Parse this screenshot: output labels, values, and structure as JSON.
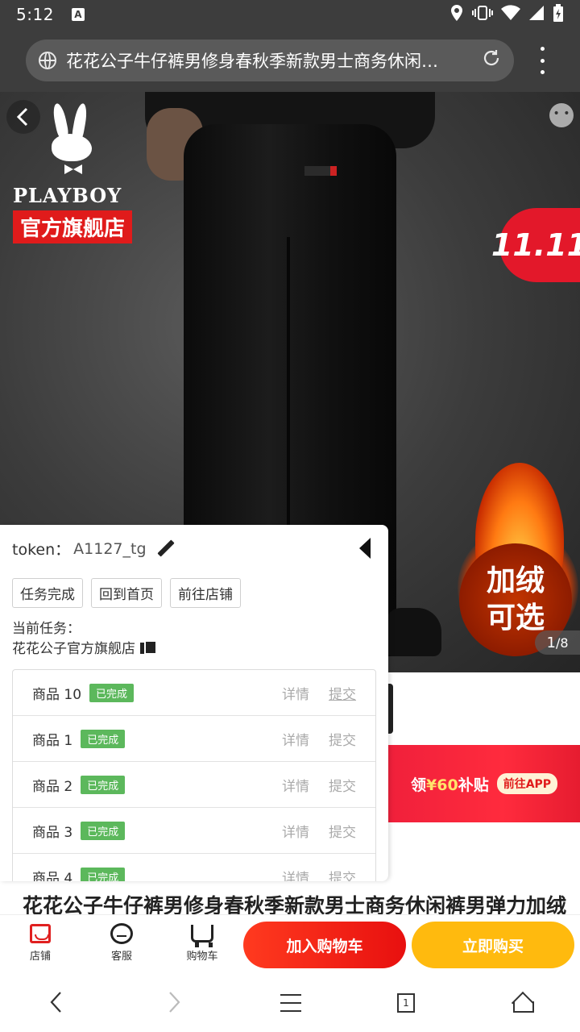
{
  "status": {
    "time": "5:12",
    "a_icon": "A"
  },
  "browser": {
    "url_title": "花花公子牛仔裤男修身春秋季新款男士商务休闲…"
  },
  "hero": {
    "brand_name": "PLAYBOY",
    "brand_store": "官方旗舰店",
    "badge": "11.11",
    "velvet_line1": "加绒",
    "velvet_line2": "可选",
    "counter_current": "1",
    "counter_total": "/8"
  },
  "promo": {
    "prefix": "领",
    "amount": "¥60",
    "suffix": "补贴",
    "button": "前往APP"
  },
  "product_title": "花花公子牛仔裤男修身春秋季新款男士商务休闲裤男弹力加绒",
  "panel": {
    "token_label": "token：",
    "token_value": "A1127_tg",
    "buttons": {
      "task_done": "任务完成",
      "back_home": "回到首页",
      "go_store": "前往店铺"
    },
    "current_task_label": "当前任务：",
    "current_task_name": "花花公子官方旗舰店",
    "rows": [
      {
        "name": "商品 10",
        "status": "已完成",
        "detail": "详情",
        "submit": "提交"
      },
      {
        "name": "商品 1",
        "status": "已完成",
        "detail": "详情",
        "submit": "提交"
      },
      {
        "name": "商品 2",
        "status": "已完成",
        "detail": "详情",
        "submit": "提交"
      },
      {
        "name": "商品 3",
        "status": "已完成",
        "detail": "详情",
        "submit": "提交"
      },
      {
        "name": "商品 4",
        "status": "已完成",
        "detail": "详情",
        "submit": "提交"
      }
    ]
  },
  "bottom_bar": {
    "shop": "店铺",
    "service": "客服",
    "cart": "购物车",
    "add_cart": "加入购物车",
    "buy_now": "立即购买"
  },
  "system_nav": {
    "tab_count": "1"
  },
  "colors": {
    "accent_red": "#e8100f",
    "buy_yellow": "#ffba0e",
    "done_green": "#5cb85c"
  }
}
